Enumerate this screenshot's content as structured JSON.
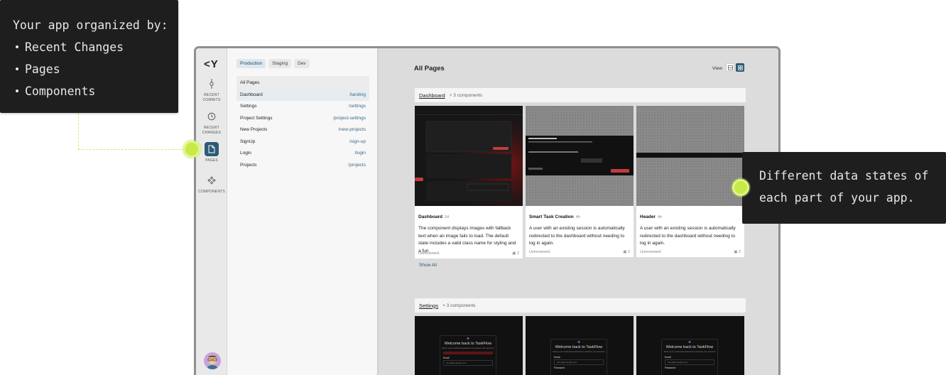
{
  "callouts": {
    "left": {
      "title": "Your app organized by:",
      "items": [
        "Recent Changes",
        "Pages",
        "Components"
      ]
    },
    "right": {
      "lines": [
        "Different data states of",
        "each part of your app."
      ]
    }
  },
  "rail": {
    "logo": "<Y",
    "items": [
      {
        "label": "RECENT COMMITS",
        "icon": "commit-icon"
      },
      {
        "label": "RECENT CHANGES",
        "icon": "clock-icon"
      },
      {
        "label": "PAGES",
        "icon": "page-icon"
      },
      {
        "label": "COMPONENTS",
        "icon": "components-icon"
      }
    ]
  },
  "env_tabs": [
    "Production",
    "Staging",
    "Dev"
  ],
  "pages": {
    "header": "All Pages",
    "rows": [
      {
        "name": "Dashboard",
        "path": "/landing"
      },
      {
        "name": "Settings",
        "path": "/settings"
      },
      {
        "name": "Project Settings",
        "path": "/project-settings"
      },
      {
        "name": "New Projects",
        "path": "/new-projects"
      },
      {
        "name": "SignUp",
        "path": "/sign-up"
      },
      {
        "name": "Login",
        "path": "/login"
      },
      {
        "name": "Projects",
        "path": "/projects"
      }
    ]
  },
  "content": {
    "title": "All Pages",
    "view_label": "View",
    "sections": [
      {
        "name": "Dashboard",
        "count": "+ 3 components"
      },
      {
        "name": "Settings",
        "count": "+ 3 components"
      }
    ],
    "cards": [
      {
        "name": "Dashboard",
        "age": "2d",
        "desc": "The component displays images with fallback text when an image fails to load. The default state includes a valid class name for styling and a fun",
        "status": "Unreviewed.",
        "count": "2"
      },
      {
        "name": "Smart Task Creation",
        "age": "4h",
        "desc": "A user with an existing session is automatically redirected to the dashboard without needing to log in again.",
        "status": "Unreviewed.",
        "count": "2"
      },
      {
        "name": "Header",
        "age": "4h",
        "desc": "A user with an existing session is automatically redirected to the dashboard without needing to log in again.",
        "status": "Unreviewed.",
        "count": "2"
      }
    ],
    "show_all": "Show All",
    "settings_thumb": {
      "title": "Welcome back to TaskFlow",
      "subtitle": "Enter your email and password to access your account",
      "email_label": "Email",
      "email_value": "name@example.com",
      "password_label": "Password"
    }
  },
  "colors": {
    "accent": "#2c5b74",
    "knob": "#c7ea47",
    "callout_bg": "#1e1e1e"
  }
}
